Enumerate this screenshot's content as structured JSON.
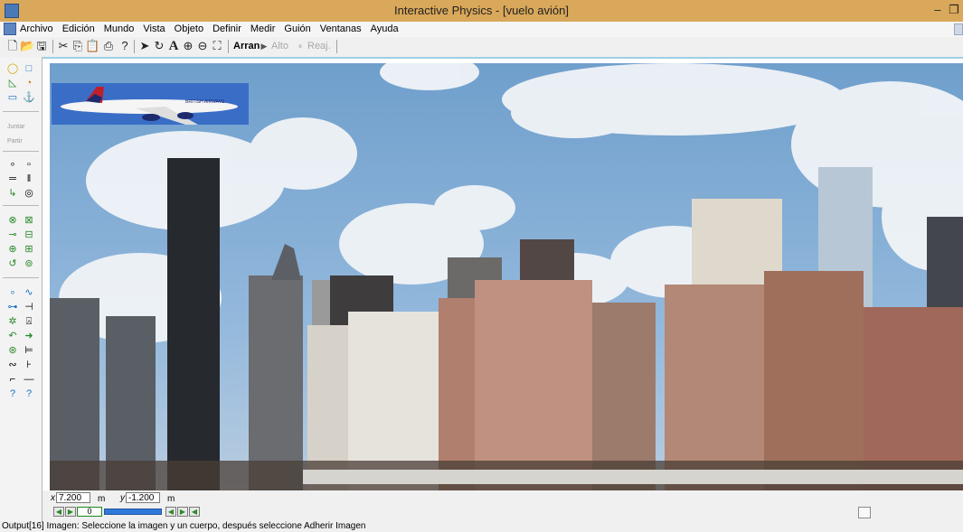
{
  "window": {
    "title": "Interactive Physics - [vuelo avión]",
    "minimize_glyph": "–",
    "restore_glyph": "❐"
  },
  "menu": {
    "items": [
      "Archivo",
      "Edición",
      "Mundo",
      "Vista",
      "Objeto",
      "Definir",
      "Medir",
      "Guión",
      "Ventanas",
      "Ayuda"
    ]
  },
  "toolbar": {
    "run_label": "Arran",
    "stop_label": "Alto",
    "reset_label": "Reaj."
  },
  "palette": {
    "join_label": "Juntar",
    "split_label": "Partir"
  },
  "coords": {
    "x_label": "x",
    "x_value": "7.200",
    "x_unit": "m",
    "y_label": "y",
    "y_value": "-1.200",
    "y_unit": "m"
  },
  "playback": {
    "frame": "0"
  },
  "status": {
    "text": "Output[16]  Imagen:  Seleccione la imagen y un cuerpo, después seleccione Adherir Imagen"
  },
  "scene": {
    "airline_text": "BRITISH AIRWAYS",
    "sky_color": "#6f9fcc",
    "brand_red": "#c0202a",
    "brand_navy": "#1d2a6e"
  },
  "icons": [
    "app-icon",
    "new-icon",
    "open-icon",
    "save-icon",
    "cut-icon",
    "copy-icon",
    "paste-icon",
    "print-icon",
    "help-icon",
    "arrow-icon",
    "rotate-icon",
    "text-icon",
    "zoom-in-icon",
    "zoom-out-icon",
    "fit-icon"
  ]
}
